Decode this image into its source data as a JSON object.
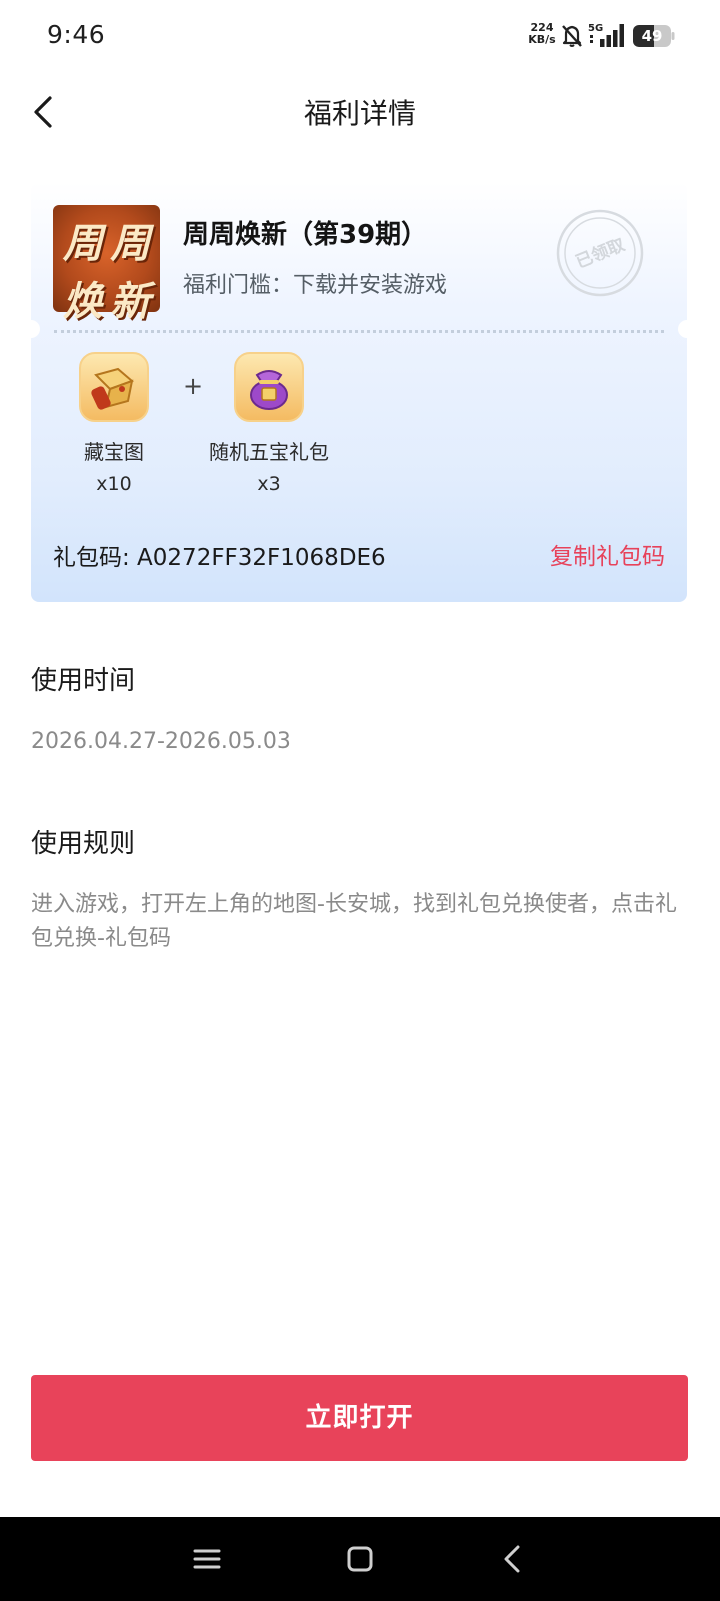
{
  "status_bar": {
    "time": "9:46",
    "net_speed_value": "224",
    "net_speed_unit": "KB/s",
    "network": "5G",
    "battery": "49",
    "icons": [
      "bell-mute-icon",
      "signal-icon",
      "battery-icon"
    ]
  },
  "nav": {
    "title": "福利详情",
    "back_icon": "chevron-left-icon"
  },
  "gift": {
    "logo_chars": [
      "周",
      "周",
      "焕",
      "新"
    ],
    "title": "周周焕新（第39期）",
    "threshold": "福利门槛：下载并安装游戏",
    "stamp_text": "已领取",
    "rewards": [
      {
        "name": "藏宝图",
        "count": "x10",
        "icon": "treasure-map-icon"
      },
      {
        "name": "随机五宝礼包",
        "count": "x3",
        "icon": "gift-bag-icon"
      }
    ],
    "plus": "+",
    "code_label": "礼包码: A0272FF32F1068DE6",
    "copy_label": "复制礼包码"
  },
  "usage_time": {
    "title": "使用时间",
    "value": "2026.04.27-2026.05.03"
  },
  "usage_rules": {
    "title": "使用规则",
    "value": "进入游戏，打开左上角的地图-长安城，找到礼包兑换使者，点击礼包兑换-礼包码"
  },
  "action": {
    "open_label": "立即打开"
  },
  "colors": {
    "accent": "#e8435a",
    "copy_text": "#e7425a",
    "card_gradient_end": "#d2e4fc"
  },
  "system_nav": {
    "icons": [
      "menu-icon",
      "home-icon",
      "back-icon"
    ]
  }
}
